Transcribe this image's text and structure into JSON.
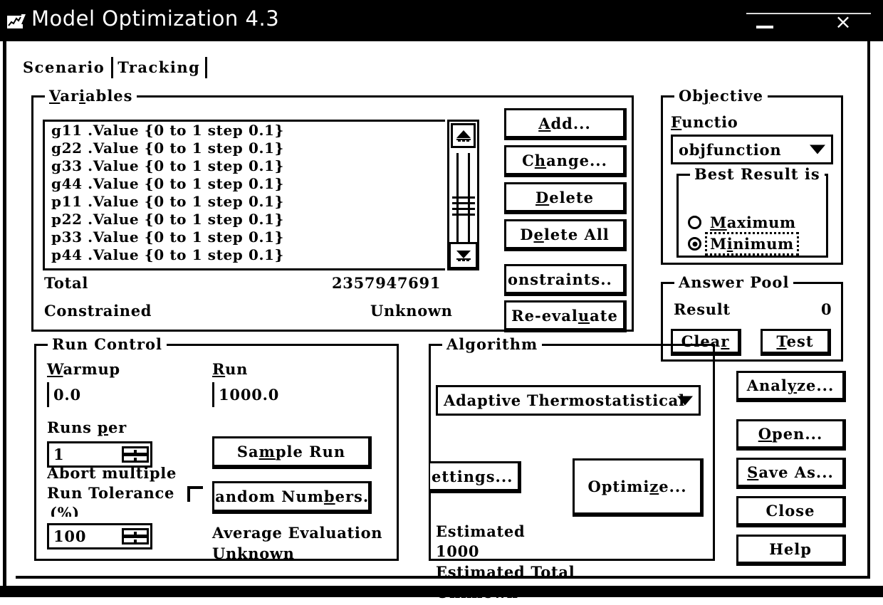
{
  "window": {
    "title": "Model Optimization 4.3",
    "icon": "chart-app-icon",
    "minimize_label": "—",
    "close_label": "×"
  },
  "tabs": [
    {
      "label": "Scenario",
      "selected": true
    },
    {
      "label": "Tracking",
      "selected": false
    }
  ],
  "variables": {
    "group_label": "Variables",
    "items": [
      "g11 .Value {0 to 1 step 0.1}",
      "g22 .Value {0 to 1 step 0.1}",
      "g33 .Value {0 to 1 step 0.1}",
      "g44 .Value {0 to 1 step 0.1}",
      "p11 .Value {0 to 1 step 0.1}",
      "p22 .Value {0 to 1 step 0.1}",
      "p33 .Value {0 to 1 step 0.1}",
      "p44 .Value {0 to 1 step 0.1}"
    ],
    "total_label": "Total",
    "total_value": "2357947691",
    "constrained_label": "Constrained",
    "constrained_value": "Unknown",
    "buttons": {
      "add": "Add...",
      "change": "Change...",
      "delete": "Delete",
      "delete_all": "Delete All",
      "constraints": "onstraints..",
      "reevaluate": "Re-evaluate"
    }
  },
  "objective": {
    "group_label": "Objective",
    "function_label": "Functio",
    "function_value": "objfunction",
    "best_result": {
      "group_label": "Best Result is",
      "options": [
        "Maximum",
        "Minimum"
      ],
      "selected": "Minimum"
    }
  },
  "answer_pool": {
    "group_label": "Answer Pool",
    "result_label": "Result",
    "result_value": "0",
    "clear_label": "Clear",
    "test_label": "Test"
  },
  "run_control": {
    "group_label": "Run Control",
    "warmup_label": "Warmup",
    "warmup_value": "0.0",
    "run_label": "Run",
    "run_value": "1000.0",
    "runs_per_label": "Runs per",
    "runs_per_value": "1",
    "abort_label_line1": "Abort multiple",
    "abort_label_line2": "Run Tolerance",
    "abort_label_line3": "(%)",
    "abort_value": "100",
    "sample_run_label": "Sample Run",
    "random_numbers_label": "Random Numbers...",
    "average_evaluation_label": "Average Evaluation",
    "average_evaluation_value": "Unknown"
  },
  "algorithm": {
    "group_label": "Algorithm",
    "selected": "Adaptive Thermostatistical",
    "settings_label": "ettings...",
    "optimize_label": "Optimize...",
    "estimated_label": "Estimated",
    "estimated_value": "1000",
    "estimated_total_label": "Estimated Total",
    "estimated_total_value": "Unknown"
  },
  "actions": {
    "analyze": "Analyze...",
    "open": "Open...",
    "save_as": "Save As...",
    "close": "Close",
    "help": "Help"
  },
  "colors": {
    "background": "#ffffff",
    "foreground": "#000000",
    "titlebar": "#000000",
    "titlebar_text": "#ffffff"
  }
}
